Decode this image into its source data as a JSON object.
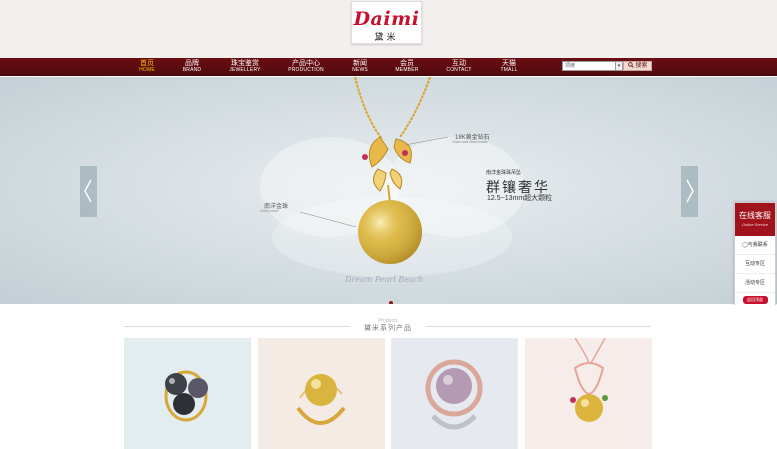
{
  "logo": {
    "text": "Daimi",
    "subtitle": "黛米"
  },
  "nav": [
    {
      "zh": "首页",
      "en": "HOME",
      "active": true
    },
    {
      "zh": "品牌",
      "en": "BRAND"
    },
    {
      "zh": "珠宝鉴赏",
      "en": "JEWELLERY"
    },
    {
      "zh": "产品中心",
      "en": "PRODUCTION"
    },
    {
      "zh": "新闻",
      "en": "NEWS"
    },
    {
      "zh": "会员",
      "en": "MEMBER"
    },
    {
      "zh": "互动",
      "en": "CONTACT"
    },
    {
      "zh": "天猫",
      "en": "TMALL"
    }
  ],
  "search": {
    "value": "项链",
    "button": "搜索",
    "drop_icon": "triangle-down"
  },
  "banner": {
    "label_diamond_zh": "18K黄金钻石",
    "label_diamond_en": "Gold and Diamonds",
    "label_pearl_zh": "南洋金珠",
    "label_pearl_en": "Gold pearl",
    "series": "南洋金珠珠吊坠",
    "headline": "群镶奢华",
    "spec": "12.5~13mm超大颗粒",
    "script": "Dream Pearl Beach",
    "slide_count": 1,
    "active_slide": 0
  },
  "service": {
    "title": "在线客服",
    "subtitle": "Online Service",
    "links": [
      "与我联系",
      "互动专区",
      "活动专区"
    ],
    "top_button": "返回顶部"
  },
  "section": {
    "script": "Products",
    "title": "黛米系列产品"
  },
  "products": [
    {
      "name": "tahitian-pearl-ring",
      "bg": "#e3ecef"
    },
    {
      "name": "gold-pearl-ring",
      "bg": "#f4ebe4"
    },
    {
      "name": "lavender-pearl-ring",
      "bg": "#e6eaf0"
    },
    {
      "name": "gold-pearl-pendant",
      "bg": "#f6ece9"
    }
  ]
}
